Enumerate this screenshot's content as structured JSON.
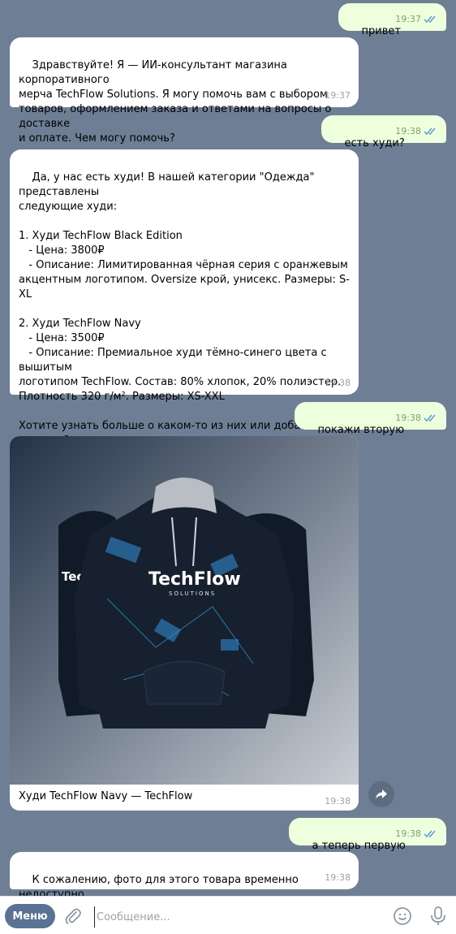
{
  "messages": [
    {
      "id": "m1",
      "text": "привет",
      "time": "19:37"
    },
    {
      "id": "m2",
      "text": "Здравствуйте! Я — ИИ-консультант магазина корпоративного\nмерча TechFlow Solutions. Я могу помочь вам с выбором\nтоваров, оформлением заказа и ответами на вопросы о доставке\nи оплате. Чем могу помочь?",
      "time": "19:37"
    },
    {
      "id": "m3",
      "text": "есть худи?",
      "time": "19:38"
    },
    {
      "id": "m4",
      "text": "Да, у нас есть худи! В нашей категории \"Одежда\" представлены\nследующие худи:\n\n1. Худи TechFlow Black Edition\n   - Цена: 3800₽\n   - Описание: Лимитированная чёрная серия с оранжевым\nакцентным логотипом. Oversize крой, унисекс. Размеры: S-XL\n\n2. Худи TechFlow Navy\n   - Цена: 3500₽\n   - Описание: Премиальное худи тёмно-синего цвета с вышитым\nлоготипом TechFlow. Состав: 80% хлопок, 20% полиэстер.\nПлотность 320 г/м². Размеры: XS-XXL\n\nХотите узнать больше о каком-то из них или добавить в\nкорзину?",
      "time": "19:38"
    },
    {
      "id": "m5",
      "text": "покажи вторую",
      "time": "19:38"
    },
    {
      "id": "m6",
      "caption": "Худи TechFlow Navy — TechFlow",
      "time": "19:38",
      "brand": "TechFlow",
      "brand_sub": "SOLUTIONS"
    },
    {
      "id": "m7",
      "text": "а теперь первую",
      "time": "19:38"
    },
    {
      "id": "m8",
      "text": "К сожалению, фото для этого товара временно недоступно.",
      "time": "19:38"
    }
  ],
  "composer": {
    "menu_label": "Меню",
    "placeholder": "Сообщение..."
  },
  "colors": {
    "background": "#6e7f95",
    "outgoing": "#eeffde",
    "incoming": "#ffffff",
    "menu_button": "#5a7293"
  }
}
